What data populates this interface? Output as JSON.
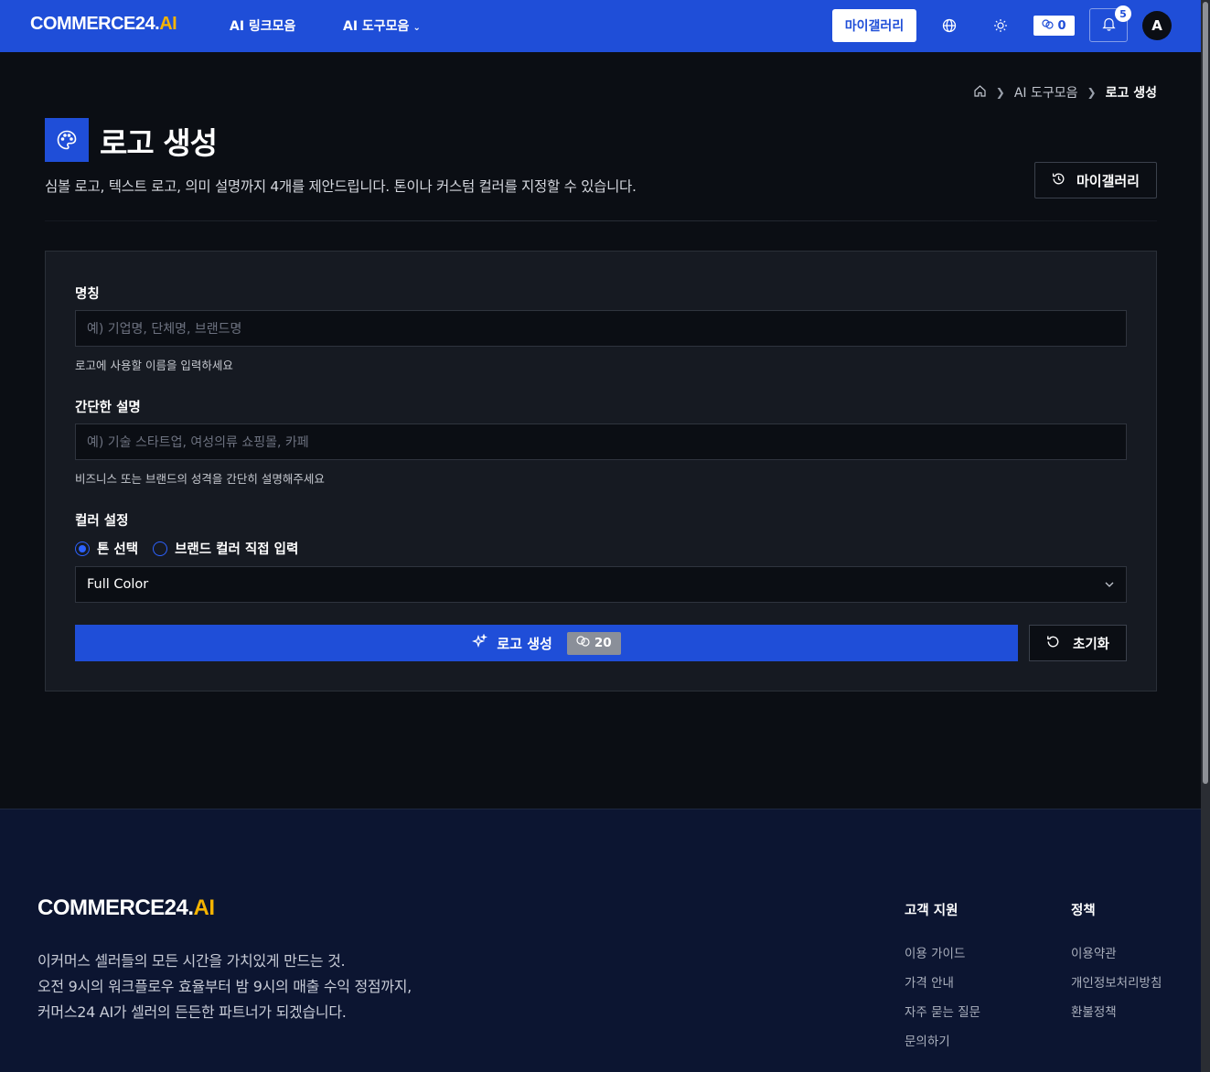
{
  "header": {
    "logo_main": "COMMERCE24.",
    "logo_accent": "AI",
    "nav_links": [
      "AI 링크모음",
      "AI 도구모음"
    ],
    "nav_dropdown_icon": "chevron-down-icon",
    "gallery_button": "마이갤러리",
    "credits": "0",
    "notification_count": "5",
    "avatar_initial": "A",
    "accent_color": "#1f4ed8",
    "brand_accent_color": "#f5b301"
  },
  "breadcrumb": {
    "home_icon": "home-icon",
    "parent": "AI 도구모음",
    "current": "로고 생성"
  },
  "page": {
    "title": "로고 생성",
    "description": "심볼 로고, 텍스트 로고, 의미 설명까지 4개를 제안드립니다. 톤이나 커스텀 컬러를 지정할 수 있습니다.",
    "gallery_button": "마이갤러리"
  },
  "form": {
    "name_label": "명칭",
    "name_placeholder": "예) 기업명, 단체명, 브랜드명",
    "name_value": "",
    "name_help": "로고에 사용할 이름을 입력하세요",
    "desc_label": "간단한 설명",
    "desc_placeholder": "예) 기술 스타트업, 여성의류 쇼핑몰, 카페",
    "desc_value": "",
    "desc_help": "비즈니스 또는 브랜드의 성격을 간단히 설명해주세요",
    "color_label": "컬러 설정",
    "radio_options": [
      {
        "label": "톤 선택",
        "checked": true
      },
      {
        "label": "브랜드 컬러 직접 입력",
        "checked": false
      }
    ],
    "tone_selected": "Full Color",
    "generate_label": "로고 생성",
    "generate_cost": "20",
    "reset_label": "초기화"
  },
  "footer": {
    "logo_main": "COMMERCE24.",
    "logo_accent": "AI",
    "tagline": [
      "이커머스 셀러들의 모든 시간을 가치있게 만드는 것.",
      "오전 9시의 워크플로우 효율부터 밤 9시의 매출 수익 정점까지,",
      "커머스24 AI가 셀러의 든든한 파트너가 되겠습니다."
    ],
    "support": {
      "title": "고객 지원",
      "links": [
        "이용 가이드",
        "가격 안내",
        "자주 묻는 질문",
        "문의하기"
      ]
    },
    "policy": {
      "title": "정책",
      "links": [
        "이용약관",
        "개인정보처리방침",
        "환불정책"
      ]
    }
  }
}
